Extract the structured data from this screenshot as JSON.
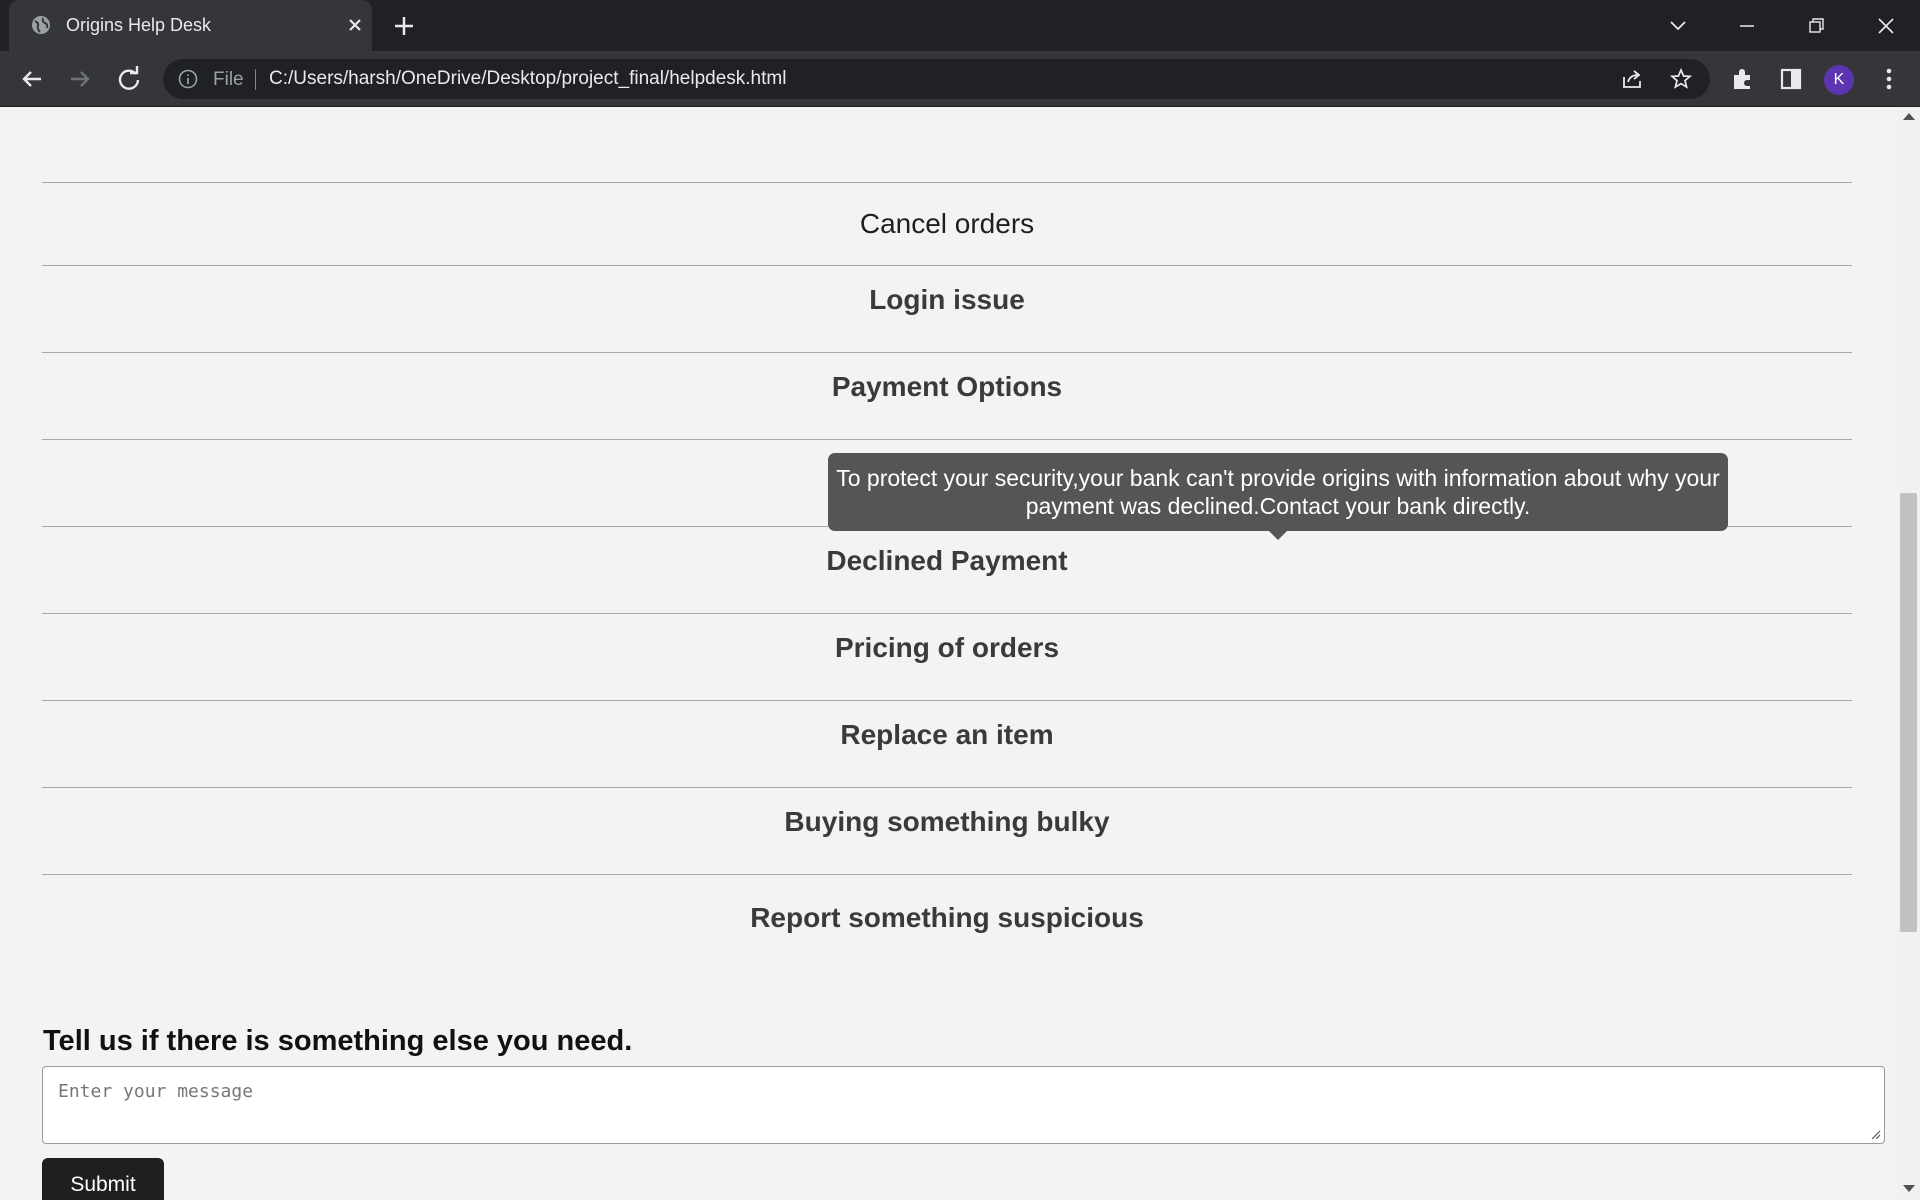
{
  "browser": {
    "tab_title": "Origins Help Desk",
    "omnibox_scheme": "File",
    "url": "C:/Users/harsh/OneDrive/Desktop/project_final/helpdesk.html",
    "profile_initial": "K",
    "colors": {
      "titlebar": "#202124",
      "toolbar": "#35363a",
      "avatar": "#5e35b1"
    }
  },
  "faq": {
    "items": [
      "Cancel orders",
      "Login issue",
      "Payment Options",
      "",
      "Declined Payment",
      "Pricing of orders",
      "Replace an item",
      "Buying something bulky",
      "Report something suspicious"
    ],
    "tooltip": "To protect your security,your bank can't provide origins with information about why your payment was declined.Contact your bank directly."
  },
  "contact": {
    "heading": "Tell us if there is something else you need.",
    "placeholder": "Enter your message",
    "submit_label": "Submit"
  }
}
